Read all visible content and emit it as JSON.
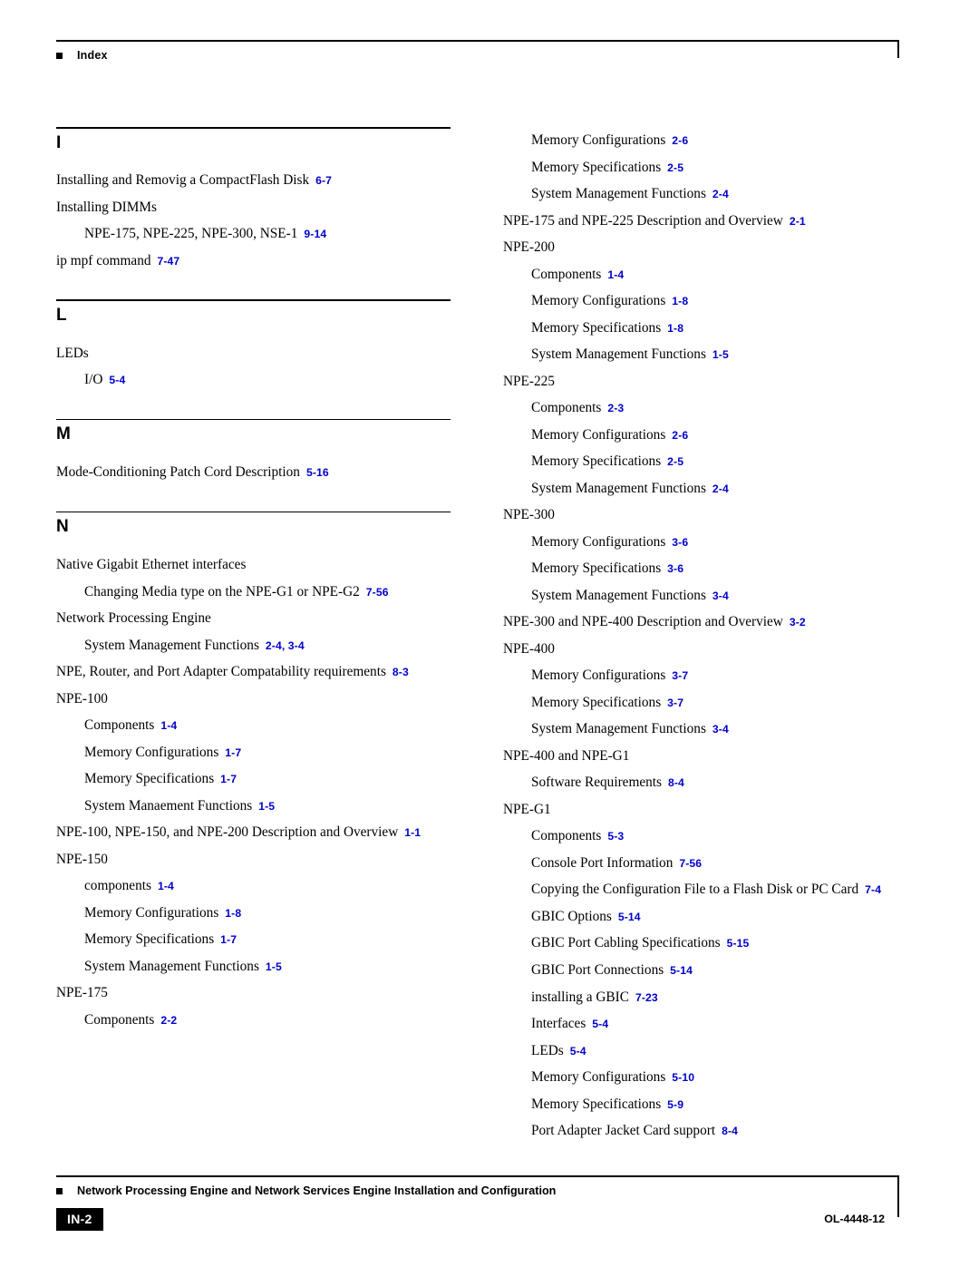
{
  "header": {
    "label": "Index"
  },
  "footer": {
    "title": "Network Processing Engine and Network Services Engine Installation and Configuration",
    "page": "IN-2",
    "doc_id": "OL-4448-12"
  },
  "colors": {
    "page_ref": "#0000cc",
    "text": "#000000",
    "footer_page_bg": "#000000"
  },
  "left_column": [
    {
      "letter": "I",
      "entries": [
        {
          "level": 0,
          "text": "Installing and Removig a CompactFlash Disk",
          "page": "6-7"
        },
        {
          "level": 0,
          "text": "Installing DIMMs",
          "page": ""
        },
        {
          "level": 1,
          "text": "NPE-175, NPE-225, NPE-300, NSE-1",
          "page": "9-14"
        },
        {
          "level": 0,
          "text": "ip mpf command",
          "page": "7-47"
        }
      ]
    },
    {
      "letter": "L",
      "entries": [
        {
          "level": 0,
          "text": "LEDs",
          "page": ""
        },
        {
          "level": 1,
          "text": "I/O",
          "page": "5-4"
        }
      ]
    },
    {
      "letter": "M",
      "entries": [
        {
          "level": 0,
          "text": "Mode-Conditioning Patch Cord Description",
          "page": "5-16"
        }
      ]
    },
    {
      "letter": "N",
      "entries": [
        {
          "level": 0,
          "text": "Native Gigabit Ethernet interfaces",
          "page": ""
        },
        {
          "level": 1,
          "text": "Changing Media type on the NPE-G1 or NPE-G2",
          "page": "7-56"
        },
        {
          "level": 0,
          "text": "Network Processing Engine",
          "page": ""
        },
        {
          "level": 1,
          "text": "System Management Functions",
          "page": "2-4, 3-4"
        },
        {
          "level": 0,
          "text": "NPE, Router, and Port Adapter Compatability requirements",
          "page": "8-3"
        },
        {
          "level": 0,
          "text": "NPE-100",
          "page": ""
        },
        {
          "level": 1,
          "text": "Components",
          "page": "1-4"
        },
        {
          "level": 1,
          "text": "Memory Configurations",
          "page": "1-7"
        },
        {
          "level": 1,
          "text": "Memory Specifications",
          "page": "1-7"
        },
        {
          "level": 1,
          "text": "System Manaement Functions",
          "page": "1-5"
        },
        {
          "level": 0,
          "text": "NPE-100, NPE-150, and NPE-200 Description and Overview",
          "page": "1-1"
        },
        {
          "level": 0,
          "text": "NPE-150",
          "page": ""
        },
        {
          "level": 1,
          "text": "components",
          "page": "1-4"
        },
        {
          "level": 1,
          "text": "Memory Configurations",
          "page": "1-8"
        },
        {
          "level": 1,
          "text": "Memory Specifications",
          "page": "1-7"
        },
        {
          "level": 1,
          "text": "System Management Functions",
          "page": "1-5"
        },
        {
          "level": 0,
          "text": "NPE-175",
          "page": ""
        },
        {
          "level": 1,
          "text": "Components",
          "page": "2-2"
        }
      ]
    }
  ],
  "right_column": [
    {
      "letter": "",
      "entries": [
        {
          "level": 1,
          "text": "Memory Configurations",
          "page": "2-6"
        },
        {
          "level": 1,
          "text": "Memory Specifications",
          "page": "2-5"
        },
        {
          "level": 1,
          "text": "System Management Functions",
          "page": "2-4"
        },
        {
          "level": 0,
          "text": "NPE-175 and NPE-225 Description and Overview",
          "page": "2-1"
        },
        {
          "level": 0,
          "text": "NPE-200",
          "page": ""
        },
        {
          "level": 1,
          "text": "Components",
          "page": "1-4"
        },
        {
          "level": 1,
          "text": "Memory Configurations",
          "page": "1-8"
        },
        {
          "level": 1,
          "text": "Memory Specifications",
          "page": "1-8"
        },
        {
          "level": 1,
          "text": "System Management Functions",
          "page": "1-5"
        },
        {
          "level": 0,
          "text": "NPE-225",
          "page": ""
        },
        {
          "level": 1,
          "text": "Components",
          "page": "2-3"
        },
        {
          "level": 1,
          "text": "Memory Configurations",
          "page": "2-6"
        },
        {
          "level": 1,
          "text": "Memory Specifications",
          "page": "2-5"
        },
        {
          "level": 1,
          "text": "System Management Functions",
          "page": "2-4"
        },
        {
          "level": 0,
          "text": "NPE-300",
          "page": ""
        },
        {
          "level": 1,
          "text": "Memory Configurations",
          "page": "3-6"
        },
        {
          "level": 1,
          "text": "Memory Specifications",
          "page": "3-6"
        },
        {
          "level": 1,
          "text": "System Management Functions",
          "page": "3-4"
        },
        {
          "level": 0,
          "text": "NPE-300 and NPE-400 Description and Overview",
          "page": "3-2"
        },
        {
          "level": 0,
          "text": "NPE-400",
          "page": ""
        },
        {
          "level": 1,
          "text": "Memory Configurations",
          "page": "3-7"
        },
        {
          "level": 1,
          "text": "Memory Specifications",
          "page": "3-7"
        },
        {
          "level": 1,
          "text": "System Management Functions",
          "page": "3-4"
        },
        {
          "level": 0,
          "text": "NPE-400 and NPE-G1",
          "page": ""
        },
        {
          "level": 1,
          "text": "Software Requirements",
          "page": "8-4"
        },
        {
          "level": 0,
          "text": "NPE-G1",
          "page": ""
        },
        {
          "level": 1,
          "text": "Components",
          "page": "5-3"
        },
        {
          "level": 1,
          "text": "Console Port Information",
          "page": "7-56"
        },
        {
          "level": 1,
          "text": "Copying the Configuration File to a Flash Disk or PC Card",
          "page": "7-4"
        },
        {
          "level": 1,
          "text": "GBIC Options",
          "page": "5-14"
        },
        {
          "level": 1,
          "text": "GBIC Port Cabling Specifications",
          "page": "5-15"
        },
        {
          "level": 1,
          "text": "GBIC Port Connections",
          "page": "5-14"
        },
        {
          "level": 1,
          "text": "installing a GBIC",
          "page": "7-23"
        },
        {
          "level": 1,
          "text": "Interfaces",
          "page": "5-4"
        },
        {
          "level": 1,
          "text": "LEDs",
          "page": "5-4"
        },
        {
          "level": 1,
          "text": "Memory Configurations",
          "page": "5-10"
        },
        {
          "level": 1,
          "text": "Memory Specifications",
          "page": "5-9"
        },
        {
          "level": 1,
          "text": "Port Adapter Jacket Card support",
          "page": "8-4"
        }
      ]
    }
  ]
}
